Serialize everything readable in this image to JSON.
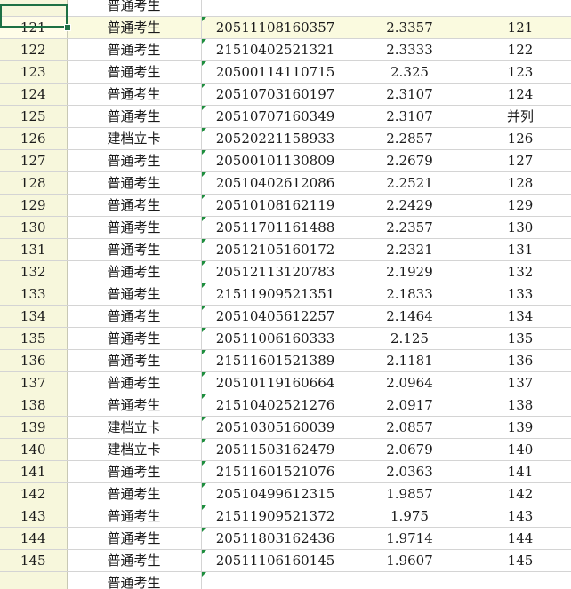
{
  "spreadsheet": {
    "rows": [
      {
        "row": "",
        "type": "普通考生",
        "id": "",
        "score": "",
        "rank": ""
      },
      {
        "row": "121",
        "type": "普通考生",
        "id": "20511108160357",
        "score": "2.3357",
        "rank": "121"
      },
      {
        "row": "122",
        "type": "普通考生",
        "id": "21510402521321",
        "score": "2.3333",
        "rank": "122"
      },
      {
        "row": "123",
        "type": "普通考生",
        "id": "20500114110715",
        "score": "2.325",
        "rank": "123"
      },
      {
        "row": "124",
        "type": "普通考生",
        "id": "20510703160197",
        "score": "2.3107",
        "rank": "124"
      },
      {
        "row": "125",
        "type": "普通考生",
        "id": "20510707160349",
        "score": "2.3107",
        "rank": "并列"
      },
      {
        "row": "126",
        "type": "建档立卡",
        "id": "20520221158933",
        "score": "2.2857",
        "rank": "126"
      },
      {
        "row": "127",
        "type": "普通考生",
        "id": "20500101130809",
        "score": "2.2679",
        "rank": "127"
      },
      {
        "row": "128",
        "type": "普通考生",
        "id": "20510402612086",
        "score": "2.2521",
        "rank": "128"
      },
      {
        "row": "129",
        "type": "普通考生",
        "id": "20510108162119",
        "score": "2.2429",
        "rank": "129"
      },
      {
        "row": "130",
        "type": "普通考生",
        "id": "20511701161488",
        "score": "2.2357",
        "rank": "130"
      },
      {
        "row": "131",
        "type": "普通考生",
        "id": "20512105160172",
        "score": "2.2321",
        "rank": "131"
      },
      {
        "row": "132",
        "type": "普通考生",
        "id": "20512113120783",
        "score": "2.1929",
        "rank": "132"
      },
      {
        "row": "133",
        "type": "普通考生",
        "id": "21511909521351",
        "score": "2.1833",
        "rank": "133"
      },
      {
        "row": "134",
        "type": "普通考生",
        "id": "20510405612257",
        "score": "2.1464",
        "rank": "134"
      },
      {
        "row": "135",
        "type": "普通考生",
        "id": "20511006160333",
        "score": "2.125",
        "rank": "135"
      },
      {
        "row": "136",
        "type": "普通考生",
        "id": "21511601521389",
        "score": "2.1181",
        "rank": "136"
      },
      {
        "row": "137",
        "type": "普通考生",
        "id": "20510119160664",
        "score": "2.0964",
        "rank": "137"
      },
      {
        "row": "138",
        "type": "普通考生",
        "id": "21510402521276",
        "score": "2.0917",
        "rank": "138"
      },
      {
        "row": "139",
        "type": "建档立卡",
        "id": "20510305160039",
        "score": "2.0857",
        "rank": "139"
      },
      {
        "row": "140",
        "type": "建档立卡",
        "id": "20511503162479",
        "score": "2.0679",
        "rank": "140"
      },
      {
        "row": "141",
        "type": "普通考生",
        "id": "21511601521076",
        "score": "2.0363",
        "rank": "141"
      },
      {
        "row": "142",
        "type": "普通考生",
        "id": "20510499612315",
        "score": "1.9857",
        "rank": "142"
      },
      {
        "row": "143",
        "type": "普通考生",
        "id": "21511909521372",
        "score": "1.975",
        "rank": "143"
      },
      {
        "row": "144",
        "type": "普通考生",
        "id": "20511803162436",
        "score": "1.9714",
        "rank": "144"
      },
      {
        "row": "145",
        "type": "普通考生",
        "id": "20511106160145",
        "score": "1.9607",
        "rank": "145"
      },
      {
        "row": "",
        "type": "普通考生",
        "id": "",
        "score": "",
        "rank": ""
      }
    ],
    "colors": {
      "row_header_bg": "#f7f7dc",
      "selection_border": "#1e7145",
      "gridline": "#d4d4d4",
      "text_indicator": "#1e8e3e"
    }
  }
}
